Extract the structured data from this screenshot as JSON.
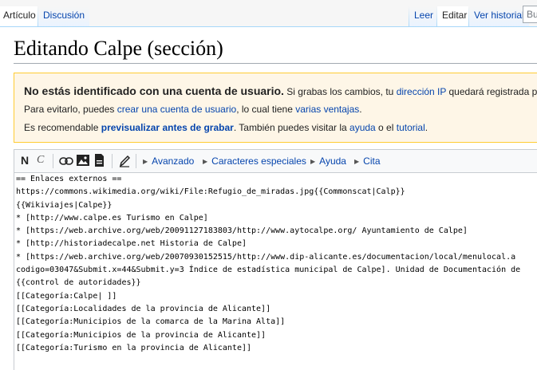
{
  "tabs": {
    "article": "Artículo",
    "discussion": "Discusión",
    "read": "Leer",
    "edit": "Editar",
    "history": "Ver historial",
    "search_placeholder": "Bu"
  },
  "page": {
    "title": "Editando Calpe (sección)"
  },
  "warning": {
    "heading": "No estás identificado con una cuenta de usuario.",
    "line1_rest_a": " Si grabas los cambios, tu ",
    "ip_link": "dirección IP",
    "line1_rest_b": " quedará registrada pública",
    "line2_a": "Para evitarlo, puedes ",
    "create_account_link": "crear una cuenta de usuario",
    "line2_b": ", lo cual tiene ",
    "advantages_link": "varias ventajas",
    "line2_c": ".",
    "line3_a": "Es recomendable ",
    "preview_strong": "previsualizar antes de grabar",
    "line3_b": ". También puedes visitar la ",
    "help_link": "ayuda",
    "line3_c": " o el ",
    "tutorial_link": "tutorial",
    "line3_d": "."
  },
  "toolbar": {
    "bold": "N",
    "italic": "C",
    "advanced": "Avanzado",
    "special_chars": "Caracteres especiales",
    "help": "Ayuda",
    "cite": "Cita"
  },
  "editor": {
    "lines": [
      "== Enlaces externos ==",
      "https://commons.wikimedia.org/wiki/File:Refugio_de_miradas.jpg{{Commonscat|Calp}}",
      "{{Wikiviajes|Calpe}}",
      "* [http://www.calpe.es Turismo en Calpe]",
      "* [https://web.archive.org/web/20091127183803/http://www.aytocalpe.org/ Ayuntamiento de Calpe]",
      "* [http://historiadecalpe.net Historia de Calpe]",
      "* [https://web.archive.org/web/20070930152515/http://www.dip-alicante.es/documentacion/local/menulocal.a",
      "codigo=03047&Submit.x=44&Submit.y=3 Índice de estadística municipal de Calpe]. Unidad de Documentación de",
      "",
      "{{control de autoridades}}",
      "[[Categoría:Calpe| ]]",
      "[[Categoría:Localidades de la provincia de Alicante]]",
      "[[Categoría:Municipios de la comarca de la Marina Alta]]",
      "[[Categoría:Municipios de la provincia de Alicante]]",
      "[[Categoría:Turismo en la provincia de Alicante]]"
    ]
  }
}
